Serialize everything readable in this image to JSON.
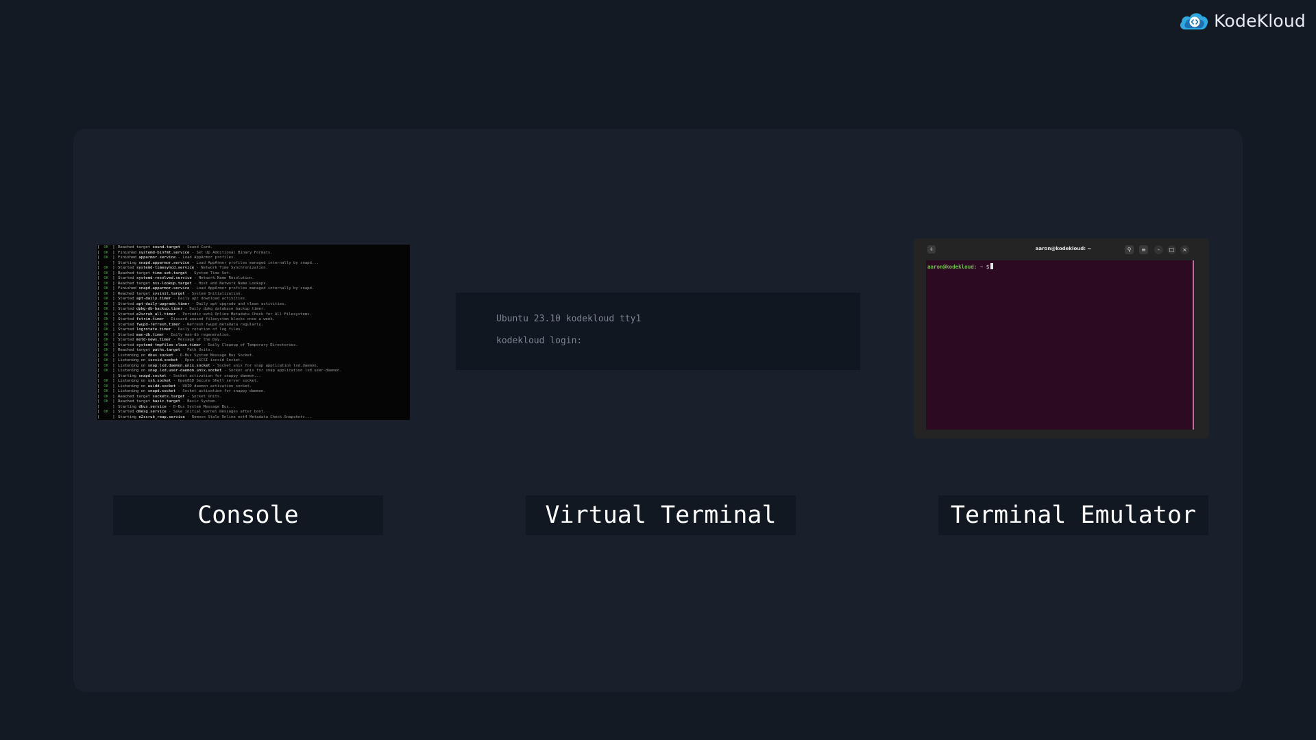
{
  "brand": {
    "name": "KodeKloud"
  },
  "colors": {
    "background": "#131a24",
    "panel": "#19202b",
    "ok_green": "#3fa43f",
    "terminal_bg": "#2c0a22",
    "accent_blue": "#2fa8e0"
  },
  "console": {
    "label": "Console",
    "log": [
      {
        "status": "OK",
        "verb": "Reached target",
        "unit": "sound.target",
        "desc": "- Sound Card."
      },
      {
        "status": "OK",
        "verb": "Finished",
        "unit": "systemd-binfmt.service",
        "desc": "- Set Up Additional Binary Formats."
      },
      {
        "status": "OK",
        "verb": "Finished",
        "unit": "apparmor.service",
        "desc": "- Load AppArmor profiles."
      },
      {
        "status": "",
        "verb": "Starting",
        "unit": "snapd.apparmor.service",
        "desc": "- Load AppArmor profiles managed internally by snapd..."
      },
      {
        "status": "OK",
        "verb": "Started",
        "unit": "systemd-timesyncd.service",
        "desc": "- Network Time Synchronization."
      },
      {
        "status": "OK",
        "verb": "Reached target",
        "unit": "time-set.target",
        "desc": "- System Time Set."
      },
      {
        "status": "OK",
        "verb": "Started",
        "unit": "systemd-resolved.service",
        "desc": "- Network Name Resolution."
      },
      {
        "status": "OK",
        "verb": "Reached target",
        "unit": "nss-lookup.target",
        "desc": "- Host and Network Name Lookups."
      },
      {
        "status": "OK",
        "verb": "Finished",
        "unit": "snapd.apparmor.service",
        "desc": "- Load AppArmor profiles managed internally by snapd."
      },
      {
        "status": "OK",
        "verb": "Reached target",
        "unit": "sysinit.target",
        "desc": "- System Initialization."
      },
      {
        "status": "OK",
        "verb": "Started",
        "unit": "apt-daily.timer",
        "desc": "- Daily apt download activities."
      },
      {
        "status": "OK",
        "verb": "Started",
        "unit": "apt-daily-upgrade.timer",
        "desc": "- Daily apt upgrade and clean activities."
      },
      {
        "status": "OK",
        "verb": "Started",
        "unit": "dpkg-db-backup.timer",
        "desc": "- Daily dpkg database backup timer."
      },
      {
        "status": "OK",
        "verb": "Started",
        "unit": "e2scrub_all.timer",
        "desc": "- Periodic ext4 Online Metadata Check for All Filesystems."
      },
      {
        "status": "OK",
        "verb": "Started",
        "unit": "fstrim.timer",
        "desc": "- Discard unused filesystem blocks once a week."
      },
      {
        "status": "OK",
        "verb": "Started",
        "unit": "fwupd-refresh.timer",
        "desc": "- Refresh fwupd metadata regularly."
      },
      {
        "status": "OK",
        "verb": "Started",
        "unit": "logrotate.timer",
        "desc": "- Daily rotation of log files."
      },
      {
        "status": "OK",
        "verb": "Started",
        "unit": "man-db.timer",
        "desc": "- Daily man-db regeneration."
      },
      {
        "status": "OK",
        "verb": "Started",
        "unit": "motd-news.timer",
        "desc": "- Message of the Day."
      },
      {
        "status": "OK",
        "verb": "Started",
        "unit": "systemd-tmpfiles-clean.timer",
        "desc": "- Daily Cleanup of Temporary Directories."
      },
      {
        "status": "OK",
        "verb": "Reached target",
        "unit": "paths.target",
        "desc": "- Path Units."
      },
      {
        "status": "OK",
        "verb": "Listening on",
        "unit": "dbus.socket",
        "desc": "- D-Bus System Message Bus Socket."
      },
      {
        "status": "OK",
        "verb": "Listening on",
        "unit": "iscsid.socket",
        "desc": "- Open-iSCSI iscsid Socket."
      },
      {
        "status": "OK",
        "verb": "Listening on",
        "unit": "snap.lxd.daemon.unix.socket",
        "desc": "- Socket unix for snap application lxd.daemon."
      },
      {
        "status": "OK",
        "verb": "Listening on",
        "unit": "snap.lxd.user-daemon.unix.socket",
        "desc": "- Socket unix for snap application lxd.user-daemon."
      },
      {
        "status": "",
        "verb": "Starting",
        "unit": "snapd.socket",
        "desc": "- Socket activation for snappy daemon..."
      },
      {
        "status": "OK",
        "verb": "Listening on",
        "unit": "ssh.socket",
        "desc": "- OpenBSD Secure Shell server socket."
      },
      {
        "status": "OK",
        "verb": "Listening on",
        "unit": "uuidd.socket",
        "desc": "- UUID daemon activation socket."
      },
      {
        "status": "OK",
        "verb": "Listening on",
        "unit": "snapd.socket",
        "desc": "- Socket activation for snappy daemon."
      },
      {
        "status": "OK",
        "verb": "Reached target",
        "unit": "sockets.target",
        "desc": "- Socket Units."
      },
      {
        "status": "OK",
        "verb": "Reached target",
        "unit": "basic.target",
        "desc": "- Basic System."
      },
      {
        "status": "",
        "verb": "Starting",
        "unit": "dbus.service",
        "desc": "- D-Bus System Message Bus..."
      },
      {
        "status": "OK",
        "verb": "Started",
        "unit": "dmesg.service",
        "desc": "- Save initial kernel messages after boot."
      },
      {
        "status": "",
        "verb": "Starting",
        "unit": "e2scrub_reap.service",
        "desc": "- Remove Stale Online ext4 Metadata Check Snapshots..."
      }
    ]
  },
  "virtual_terminal": {
    "label": "Virtual Terminal",
    "line1": "Ubuntu 23.10 kodekloud tty1",
    "line2": "kodekloud login:"
  },
  "terminal_emulator": {
    "label": "Terminal Emulator",
    "window_title": "aaron@kodekloud: ~",
    "prompt_user": "aaron@kodekloud",
    "prompt_rest": ": ~ $"
  }
}
